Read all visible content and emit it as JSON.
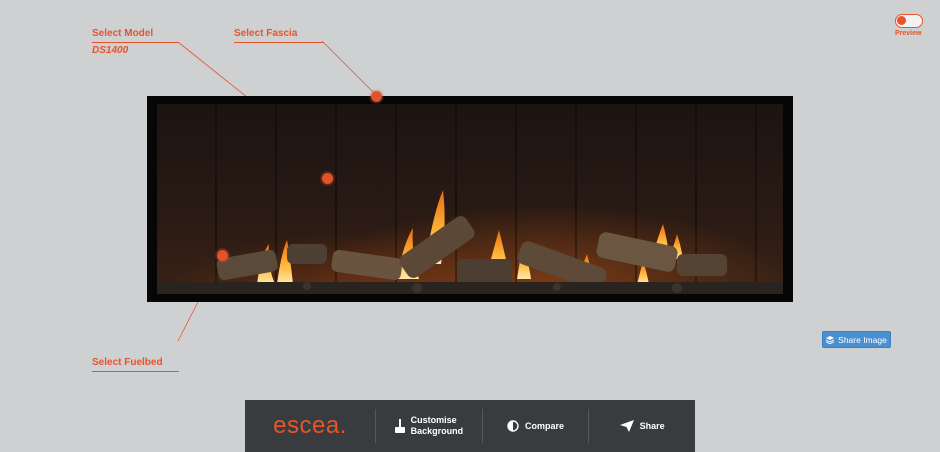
{
  "annotations": {
    "select_model": "Select Model",
    "model_value": "DS1400",
    "select_fascia": "Select Fascia",
    "select_fuelbed": "Select Fuelbed"
  },
  "preview": {
    "label": "Preview",
    "enabled": false
  },
  "share_image": {
    "label": "Share Image",
    "icon": "layers-icon"
  },
  "bottom_bar": {
    "logo": "escea",
    "items": [
      {
        "line1": "Customise",
        "line2": "Background",
        "icon": "paint-roller-icon"
      },
      {
        "label": "Compare",
        "icon": "contrast-icon"
      },
      {
        "label": "Share",
        "icon": "paper-plane-icon"
      }
    ]
  },
  "colors": {
    "accent": "#e8542a",
    "background": "#cfd0d2",
    "bar": "#383c3f",
    "share_button": "#4a90d0"
  }
}
